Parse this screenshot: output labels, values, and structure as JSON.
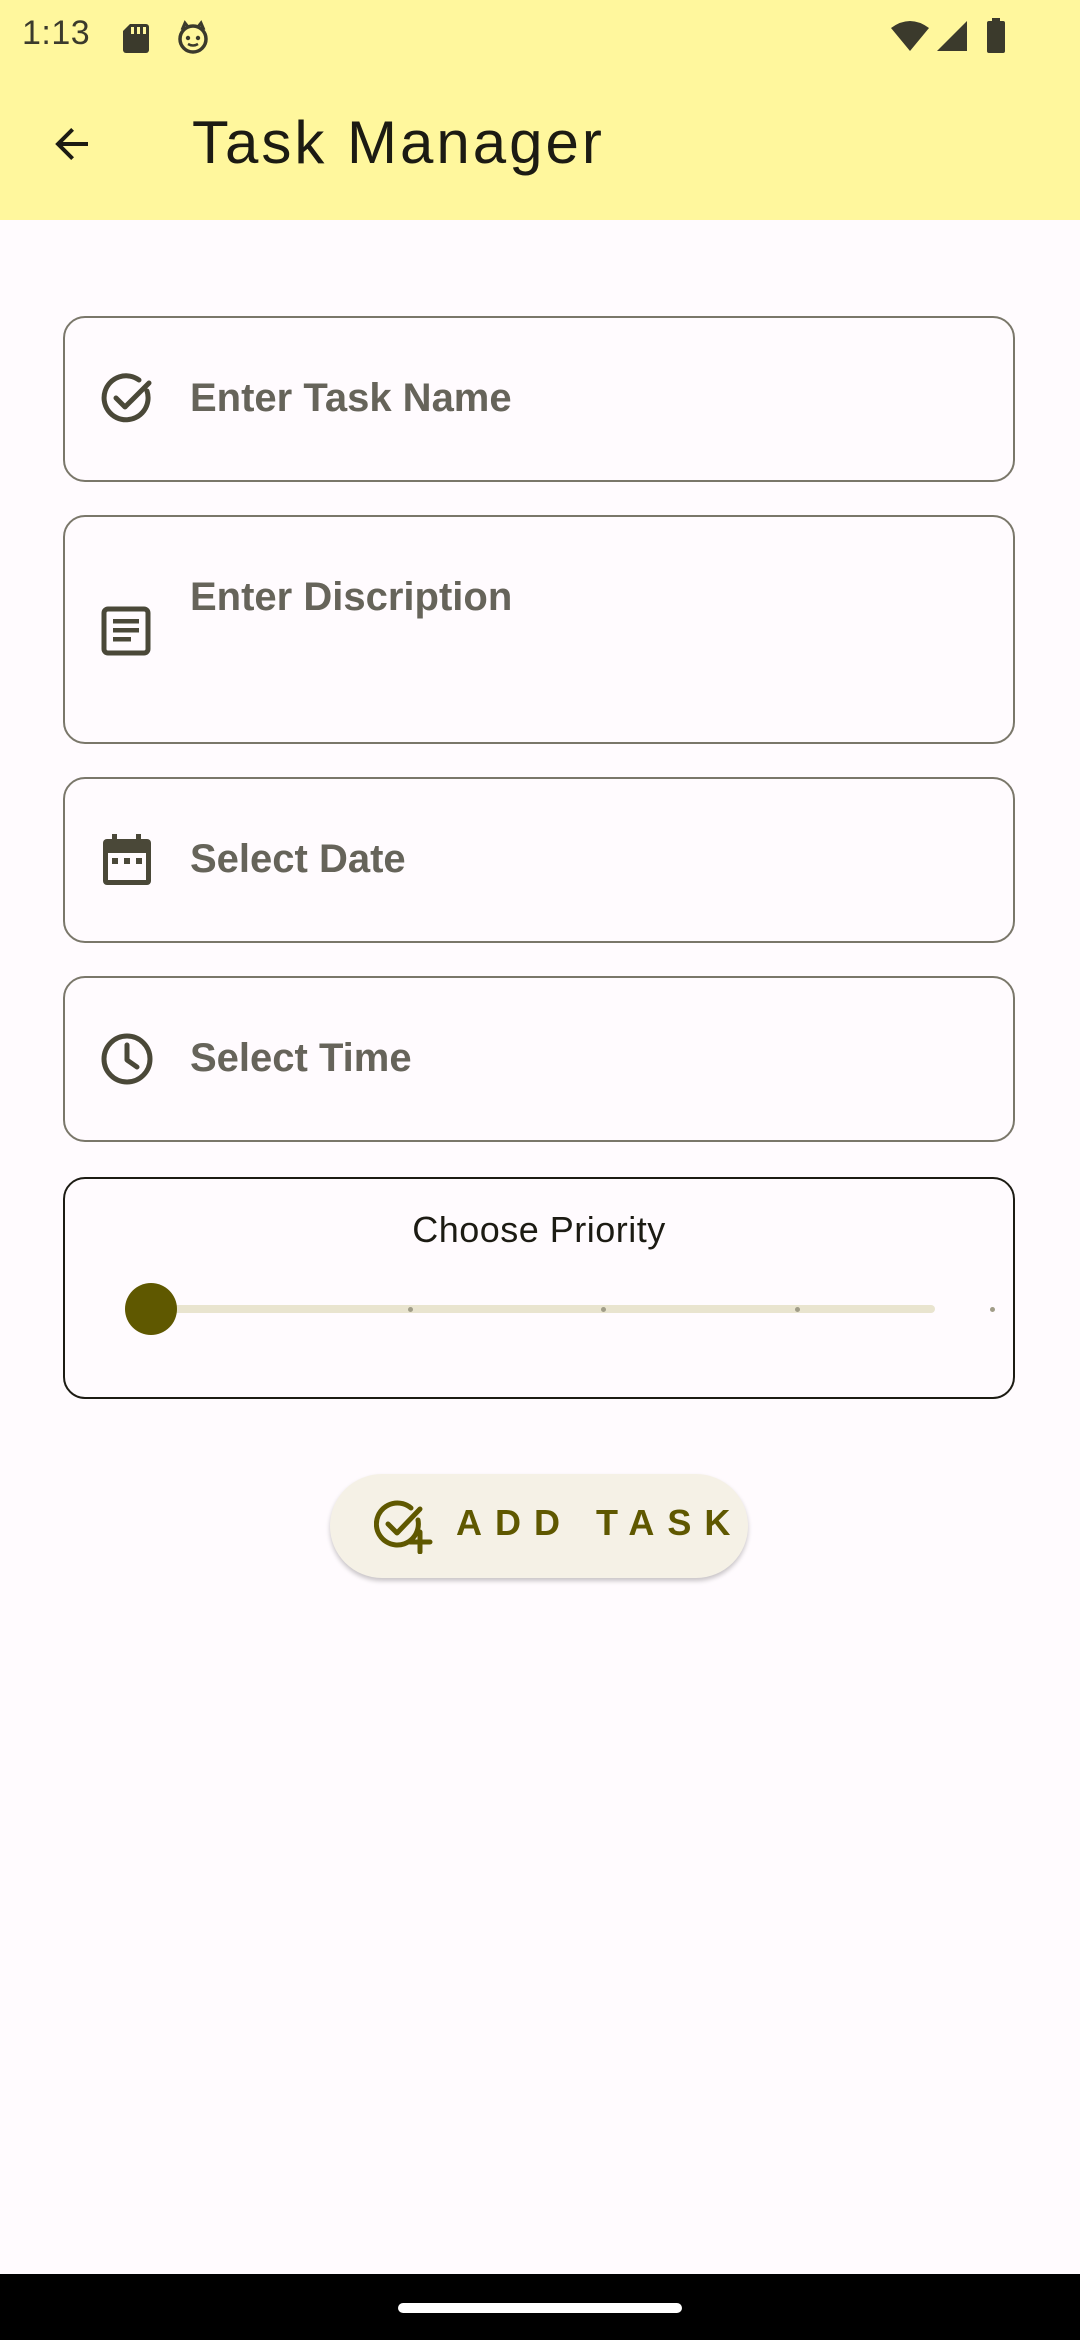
{
  "status_bar": {
    "time": "1:13",
    "icons": [
      "sd-card-icon",
      "notification-face-icon",
      "wifi-icon",
      "signal-icon",
      "battery-icon"
    ]
  },
  "app_bar": {
    "title": "Task Manager",
    "back_icon": "arrow-back-icon"
  },
  "form": {
    "task_name": {
      "placeholder": "Enter Task Name",
      "icon": "check-circle-icon"
    },
    "description": {
      "placeholder": "Enter Discription",
      "icon": "notes-icon"
    },
    "date": {
      "placeholder": "Select Date",
      "icon": "calendar-icon"
    },
    "time": {
      "placeholder": "Select Time",
      "icon": "clock-icon"
    },
    "priority": {
      "label": "Choose Priority",
      "value": 0,
      "min": 0,
      "max": 4,
      "divisions": 4
    },
    "submit": {
      "label": "ADD TASK",
      "icon": "add-task-icon"
    }
  },
  "colors": {
    "app_bar_bg": "#fff79d",
    "accent": "#5f5800",
    "background": "#fffbfe",
    "placeholder_text": "#66645a"
  }
}
